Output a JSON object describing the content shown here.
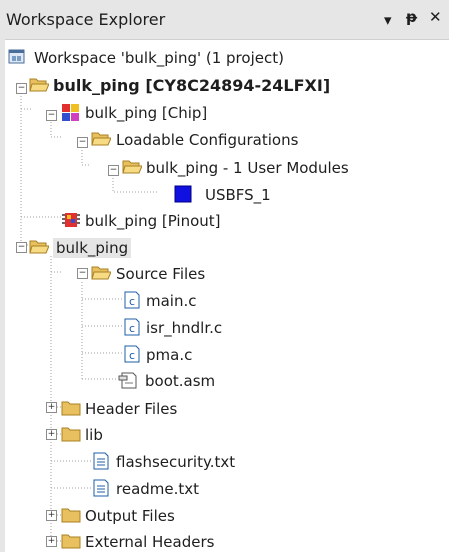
{
  "panel": {
    "title": "Workspace Explorer",
    "buttons": {
      "dropdown": "▾",
      "pin": "ᵽ",
      "close": "✕"
    }
  },
  "tree": [
    {
      "name": "workspace-node",
      "label": "Workspace 'bulk_ping' (1 project)",
      "icon": "workspace-icon"
    },
    {
      "name": "project-node",
      "label": "bulk_ping [CY8C24894-24LFXI]",
      "icon": "folder-open-icon",
      "expander": "−"
    },
    {
      "name": "chip-node",
      "label": "bulk_ping [Chip]",
      "icon": "chip-icon",
      "expander": "−"
    },
    {
      "name": "loadable-configurations-node",
      "label": "Loadable Configurations",
      "icon": "folder-open-icon",
      "expander": "−"
    },
    {
      "name": "user-modules-node",
      "label": "bulk_ping - 1 User Modules",
      "icon": "folder-open-icon",
      "expander": "−"
    },
    {
      "name": "usbfs-node",
      "label": "USBFS_1",
      "icon": "usb-module-icon"
    },
    {
      "name": "pinout-node",
      "label": "bulk_ping [Pinout]",
      "icon": "pinout-icon"
    },
    {
      "name": "bulk-ping-folder-node",
      "label": "bulk_ping",
      "icon": "folder-open-icon",
      "expander": "−"
    },
    {
      "name": "source-files-node",
      "label": "Source Files",
      "icon": "folder-open-icon",
      "expander": "−"
    },
    {
      "name": "main-c-node",
      "label": "main.c",
      "icon": "c-file-icon"
    },
    {
      "name": "isr-hndlr-c-node",
      "label": "isr_hndlr.c",
      "icon": "c-file-icon"
    },
    {
      "name": "pma-c-node",
      "label": "pma.c",
      "icon": "c-file-icon"
    },
    {
      "name": "boot-asm-node",
      "label": "boot.asm",
      "icon": "asm-file-icon"
    },
    {
      "name": "header-files-node",
      "label": "Header Files",
      "icon": "folder-closed-icon",
      "expander": "+"
    },
    {
      "name": "lib-node",
      "label": "lib",
      "icon": "folder-closed-icon",
      "expander": "+"
    },
    {
      "name": "flashsecurity-txt-node",
      "label": "flashsecurity.txt",
      "icon": "text-file-icon"
    },
    {
      "name": "readme-txt-node",
      "label": "readme.txt",
      "icon": "text-file-icon"
    },
    {
      "name": "output-files-node",
      "label": "Output Files",
      "icon": "folder-closed-icon",
      "expander": "+"
    },
    {
      "name": "external-headers-node",
      "label": "External Headers",
      "icon": "folder-closed-icon",
      "expander": "+"
    }
  ],
  "colors": {
    "titlebar": "#e6e6e6",
    "folder": "#e8c060",
    "usb_module": "#1010e0",
    "c_file_accent": "#1c5ca8",
    "selection": "#e5e5e5"
  }
}
